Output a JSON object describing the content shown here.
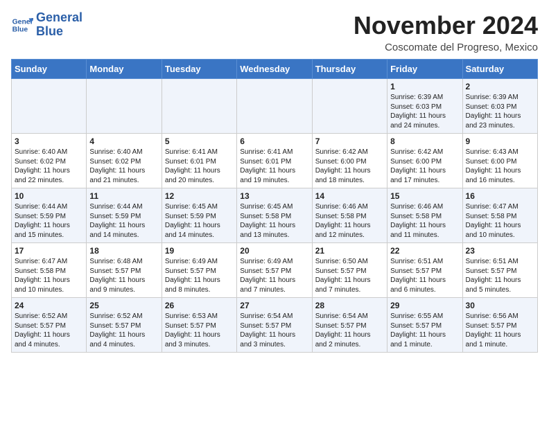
{
  "logo": {
    "line1": "General",
    "line2": "Blue"
  },
  "header": {
    "month": "November 2024",
    "location": "Coscomate del Progreso, Mexico"
  },
  "weekdays": [
    "Sunday",
    "Monday",
    "Tuesday",
    "Wednesday",
    "Thursday",
    "Friday",
    "Saturday"
  ],
  "weeks": [
    [
      {
        "day": "",
        "content": ""
      },
      {
        "day": "",
        "content": ""
      },
      {
        "day": "",
        "content": ""
      },
      {
        "day": "",
        "content": ""
      },
      {
        "day": "",
        "content": ""
      },
      {
        "day": "1",
        "content": "Sunrise: 6:39 AM\nSunset: 6:03 PM\nDaylight: 11 hours\nand 24 minutes."
      },
      {
        "day": "2",
        "content": "Sunrise: 6:39 AM\nSunset: 6:03 PM\nDaylight: 11 hours\nand 23 minutes."
      }
    ],
    [
      {
        "day": "3",
        "content": "Sunrise: 6:40 AM\nSunset: 6:02 PM\nDaylight: 11 hours\nand 22 minutes."
      },
      {
        "day": "4",
        "content": "Sunrise: 6:40 AM\nSunset: 6:02 PM\nDaylight: 11 hours\nand 21 minutes."
      },
      {
        "day": "5",
        "content": "Sunrise: 6:41 AM\nSunset: 6:01 PM\nDaylight: 11 hours\nand 20 minutes."
      },
      {
        "day": "6",
        "content": "Sunrise: 6:41 AM\nSunset: 6:01 PM\nDaylight: 11 hours\nand 19 minutes."
      },
      {
        "day": "7",
        "content": "Sunrise: 6:42 AM\nSunset: 6:00 PM\nDaylight: 11 hours\nand 18 minutes."
      },
      {
        "day": "8",
        "content": "Sunrise: 6:42 AM\nSunset: 6:00 PM\nDaylight: 11 hours\nand 17 minutes."
      },
      {
        "day": "9",
        "content": "Sunrise: 6:43 AM\nSunset: 6:00 PM\nDaylight: 11 hours\nand 16 minutes."
      }
    ],
    [
      {
        "day": "10",
        "content": "Sunrise: 6:44 AM\nSunset: 5:59 PM\nDaylight: 11 hours\nand 15 minutes."
      },
      {
        "day": "11",
        "content": "Sunrise: 6:44 AM\nSunset: 5:59 PM\nDaylight: 11 hours\nand 14 minutes."
      },
      {
        "day": "12",
        "content": "Sunrise: 6:45 AM\nSunset: 5:59 PM\nDaylight: 11 hours\nand 14 minutes."
      },
      {
        "day": "13",
        "content": "Sunrise: 6:45 AM\nSunset: 5:58 PM\nDaylight: 11 hours\nand 13 minutes."
      },
      {
        "day": "14",
        "content": "Sunrise: 6:46 AM\nSunset: 5:58 PM\nDaylight: 11 hours\nand 12 minutes."
      },
      {
        "day": "15",
        "content": "Sunrise: 6:46 AM\nSunset: 5:58 PM\nDaylight: 11 hours\nand 11 minutes."
      },
      {
        "day": "16",
        "content": "Sunrise: 6:47 AM\nSunset: 5:58 PM\nDaylight: 11 hours\nand 10 minutes."
      }
    ],
    [
      {
        "day": "17",
        "content": "Sunrise: 6:47 AM\nSunset: 5:58 PM\nDaylight: 11 hours\nand 10 minutes."
      },
      {
        "day": "18",
        "content": "Sunrise: 6:48 AM\nSunset: 5:57 PM\nDaylight: 11 hours\nand 9 minutes."
      },
      {
        "day": "19",
        "content": "Sunrise: 6:49 AM\nSunset: 5:57 PM\nDaylight: 11 hours\nand 8 minutes."
      },
      {
        "day": "20",
        "content": "Sunrise: 6:49 AM\nSunset: 5:57 PM\nDaylight: 11 hours\nand 7 minutes."
      },
      {
        "day": "21",
        "content": "Sunrise: 6:50 AM\nSunset: 5:57 PM\nDaylight: 11 hours\nand 7 minutes."
      },
      {
        "day": "22",
        "content": "Sunrise: 6:51 AM\nSunset: 5:57 PM\nDaylight: 11 hours\nand 6 minutes."
      },
      {
        "day": "23",
        "content": "Sunrise: 6:51 AM\nSunset: 5:57 PM\nDaylight: 11 hours\nand 5 minutes."
      }
    ],
    [
      {
        "day": "24",
        "content": "Sunrise: 6:52 AM\nSunset: 5:57 PM\nDaylight: 11 hours\nand 4 minutes."
      },
      {
        "day": "25",
        "content": "Sunrise: 6:52 AM\nSunset: 5:57 PM\nDaylight: 11 hours\nand 4 minutes."
      },
      {
        "day": "26",
        "content": "Sunrise: 6:53 AM\nSunset: 5:57 PM\nDaylight: 11 hours\nand 3 minutes."
      },
      {
        "day": "27",
        "content": "Sunrise: 6:54 AM\nSunset: 5:57 PM\nDaylight: 11 hours\nand 3 minutes."
      },
      {
        "day": "28",
        "content": "Sunrise: 6:54 AM\nSunset: 5:57 PM\nDaylight: 11 hours\nand 2 minutes."
      },
      {
        "day": "29",
        "content": "Sunrise: 6:55 AM\nSunset: 5:57 PM\nDaylight: 11 hours\nand 1 minute."
      },
      {
        "day": "30",
        "content": "Sunrise: 6:56 AM\nSunset: 5:57 PM\nDaylight: 11 hours\nand 1 minute."
      }
    ]
  ]
}
